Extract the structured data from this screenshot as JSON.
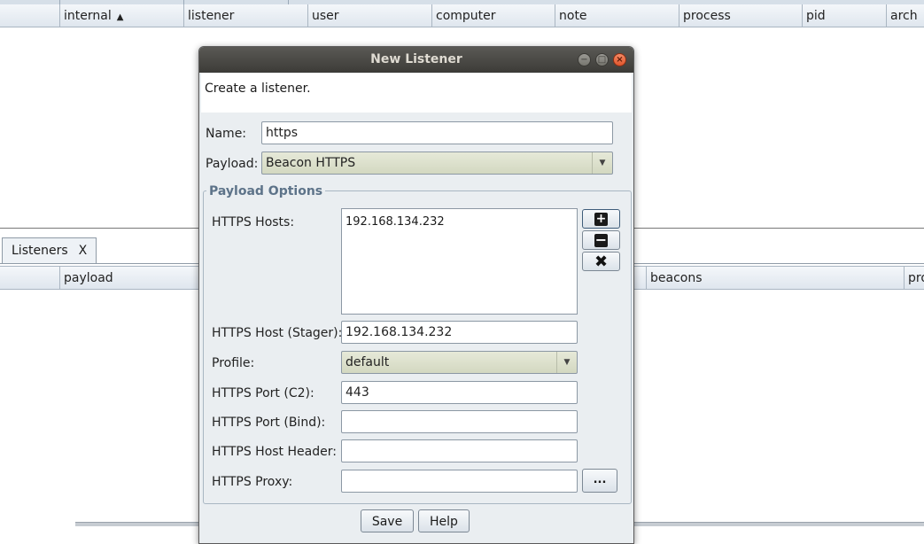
{
  "sessions_table": {
    "columns": [
      {
        "label": ""
      },
      {
        "label": "internal",
        "sorted": "ascending"
      },
      {
        "label": "listener"
      },
      {
        "label": "user"
      },
      {
        "label": "computer"
      },
      {
        "label": "note"
      },
      {
        "label": "process"
      },
      {
        "label": "pid"
      },
      {
        "label": "arch"
      }
    ],
    "sort_glyph": "▲"
  },
  "tabs": [
    {
      "label": "Listeners",
      "close": "X",
      "active": true
    }
  ],
  "listeners_table": {
    "columns": [
      {
        "label": ""
      },
      {
        "label": "payload"
      },
      {
        "label": "beacons"
      },
      {
        "label": "pro"
      }
    ]
  },
  "dialog": {
    "title": "New Listener",
    "window_buttons": {
      "minimize": "−",
      "maximize": "□",
      "close": "×"
    },
    "description": "Create a listener.",
    "name": {
      "label": "Name:",
      "value": "https"
    },
    "payload": {
      "label": "Payload:",
      "value": "Beacon HTTPS",
      "arrow": "▼"
    },
    "payload_options": {
      "title": "Payload Options",
      "hosts": {
        "label": "HTTPS Hosts:",
        "items": [
          "192.168.134.232"
        ]
      },
      "host_buttons": {
        "add": "+",
        "remove": "−",
        "clear": "✖"
      },
      "host_stager": {
        "label": "HTTPS Host (Stager):",
        "value": "192.168.134.232"
      },
      "profile": {
        "label": "Profile:",
        "value": "default",
        "arrow": "▼"
      },
      "port_c2": {
        "label": "HTTPS Port (C2):",
        "value": "443"
      },
      "port_bind": {
        "label": "HTTPS Port (Bind):",
        "value": ""
      },
      "host_header": {
        "label": "HTTPS Host Header:",
        "value": ""
      },
      "proxy": {
        "label": "HTTPS Proxy:",
        "value": "",
        "button": "..."
      }
    },
    "buttons": {
      "save": "Save",
      "help": "Help"
    }
  },
  "colors": {
    "titlebar": "#3c3b37",
    "dialog_bg": "#eaeef1",
    "combo_bg": "#d3d8c1",
    "group_title": "#5d7389",
    "close_button": "#e0562d"
  },
  "icons": [
    "sort-ascending-icon",
    "minimize-icon",
    "maximize-icon",
    "close-icon",
    "plus-icon",
    "minus-icon",
    "clear-icon",
    "dropdown-arrow-icon",
    "ellipsis-icon"
  ]
}
